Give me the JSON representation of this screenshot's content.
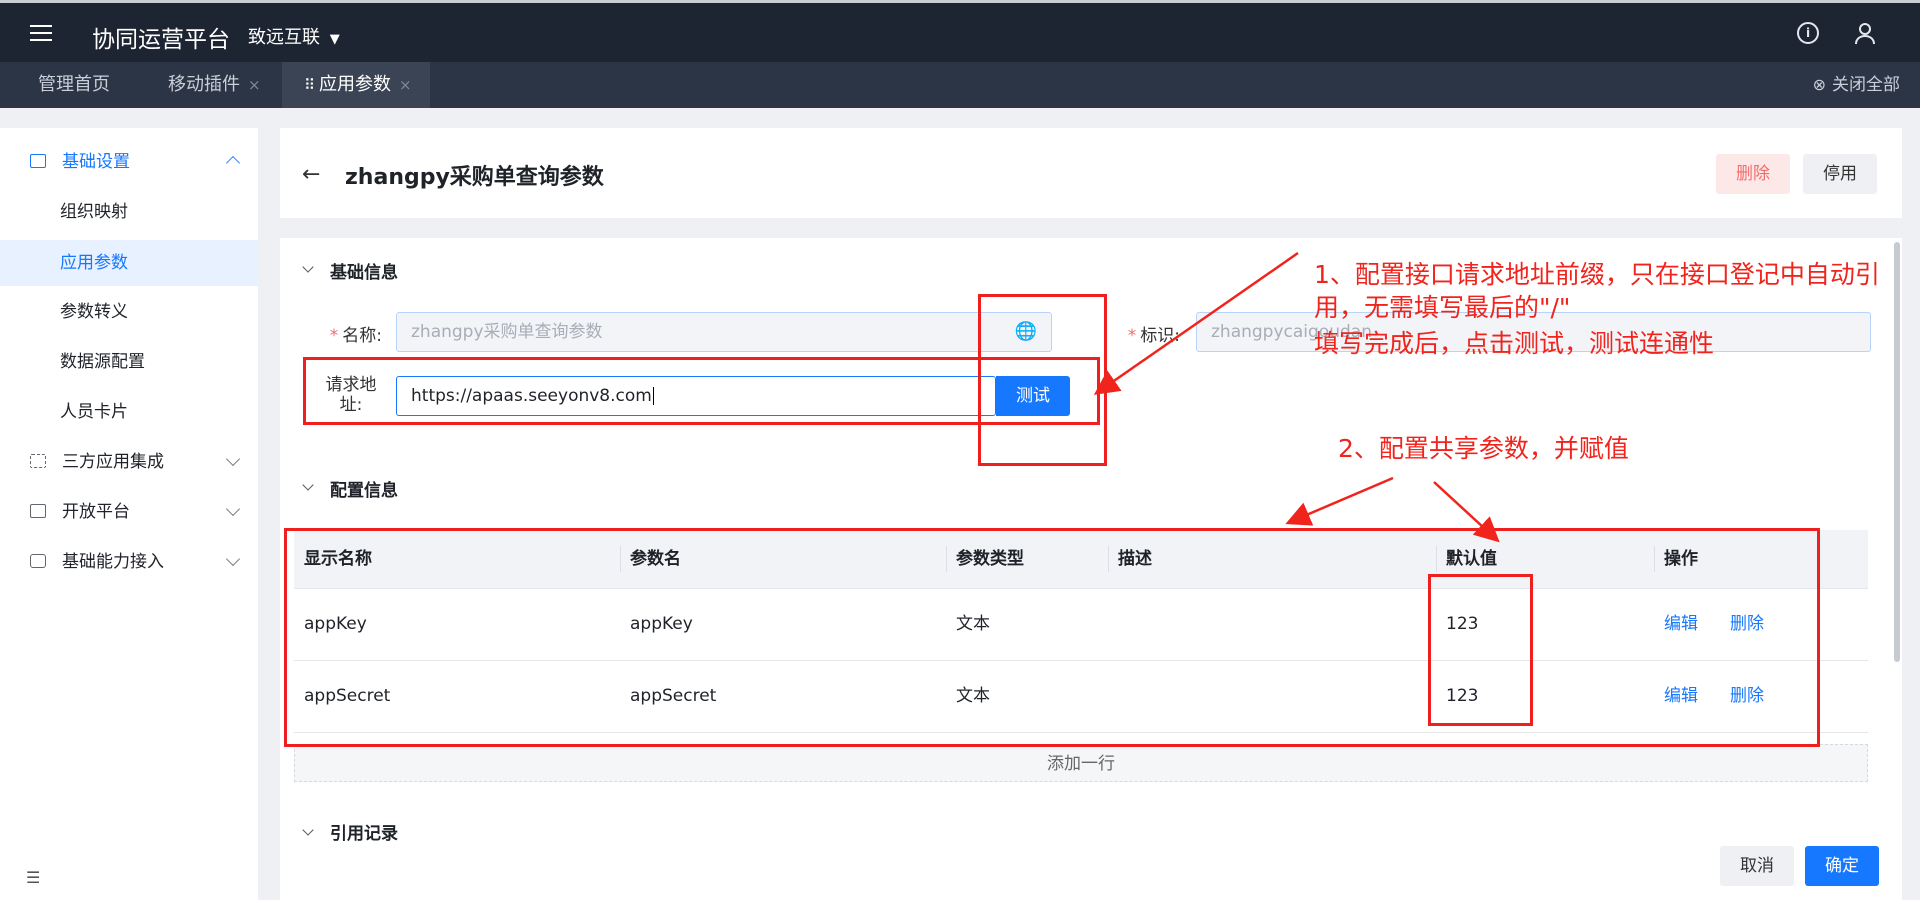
{
  "topbar": {
    "app_title": "协同运营平台",
    "org_name": "致远互联",
    "bg_color": "#1d2533"
  },
  "tabs": [
    {
      "label": "管理首页",
      "closable": false,
      "active": false
    },
    {
      "label": "移动插件",
      "closable": true,
      "active": false
    },
    {
      "label": "应用参数",
      "closable": true,
      "active": true
    }
  ],
  "tab_close_glyph": "×",
  "close_all_label": "关闭全部",
  "sidebar": {
    "groups": [
      {
        "label": "基础设置",
        "icon": "monitor-settings-icon",
        "expanded": true,
        "children": [
          "组织映射",
          "应用参数",
          "参数转义",
          "数据源配置",
          "人员卡片"
        ],
        "active_child": "应用参数"
      },
      {
        "label": "三方应用集成",
        "icon": "integration-icon",
        "expanded": false
      },
      {
        "label": "开放平台",
        "icon": "monitor-icon",
        "expanded": false
      },
      {
        "label": "基础能力接入",
        "icon": "sliders-icon",
        "expanded": false
      }
    ],
    "collapse_icon": "collapse-menu-icon"
  },
  "header": {
    "title": "zhangpy采购单查询参数",
    "delete_label": "删除",
    "disable_label": "停用"
  },
  "basic_info": {
    "section_title": "基础信息",
    "name_label": "名称:",
    "name_placeholder": "zhangpy采购单查询参数",
    "id_label": "标识:",
    "id_value": "zhangpycaigoudan",
    "url_label": "请求地址:",
    "url_value": "https://apaas.seeyonv8.com",
    "test_label": "测试"
  },
  "config_info": {
    "section_title": "配置信息",
    "columns": [
      "显示名称",
      "参数名",
      "参数类型",
      "描述",
      "默认值",
      "操作"
    ],
    "rows": [
      {
        "display": "appKey",
        "param": "appKey",
        "type": "文本",
        "desc": "",
        "default": "123",
        "edit": "编辑",
        "delete": "删除"
      },
      {
        "display": "appSecret",
        "param": "appSecret",
        "type": "文本",
        "desc": "",
        "default": "123",
        "edit": "编辑",
        "delete": "删除"
      }
    ],
    "add_row_label": "添加一行"
  },
  "reference": {
    "section_title": "引用记录"
  },
  "footer": {
    "cancel_label": "取消",
    "confirm_label": "确定"
  },
  "annotations": {
    "note1_line1": "1、配置接口请求地址前缀，只在接口登记中自动引",
    "note1_line2": "用，无需填写最后的\"/\"",
    "note1_line3": "填写完成后，点击测试，测试连通性",
    "note2": "2、配置共享参数，并赋值",
    "color": "#f0241c"
  },
  "colors": {
    "accent": "#1677ff",
    "danger": "#f56c6c",
    "required": "#f56c6c"
  }
}
